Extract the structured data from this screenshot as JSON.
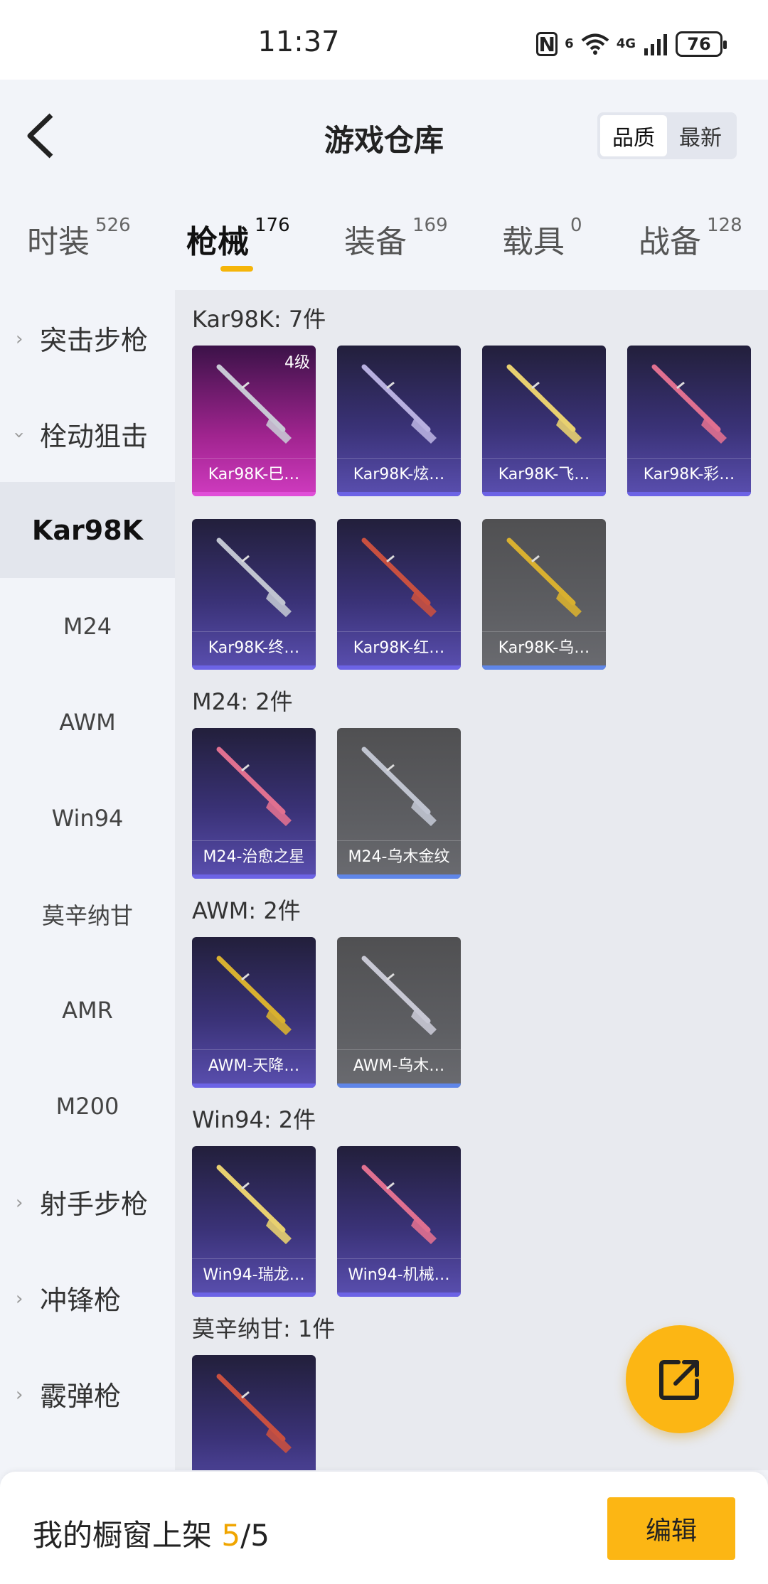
{
  "status_bar": {
    "time": "11:37",
    "battery": "76",
    "network": "4G",
    "wifi_badge": "6"
  },
  "header": {
    "title": "游戏仓库",
    "sort_options": [
      "品质",
      "最新"
    ],
    "active_sort": "品质"
  },
  "tabs": [
    {
      "label": "时装",
      "count": "526"
    },
    {
      "label": "枪械",
      "count": "176",
      "active": true
    },
    {
      "label": "装备",
      "count": "169"
    },
    {
      "label": "载具",
      "count": "0"
    },
    {
      "label": "战备",
      "count": "128"
    }
  ],
  "sidebar": {
    "group1": "突击步枪",
    "group2": "栓动狙击",
    "sub": [
      "Kar98K",
      "M24",
      "AWM",
      "Win94",
      "莫辛纳甘",
      "AMR",
      "M200"
    ],
    "active_sub": "Kar98K",
    "group3": "射手步枪",
    "group4": "冲锋枪",
    "group5": "霰弹枪"
  },
  "sections": [
    {
      "title": "Kar98K: 7件",
      "items": [
        {
          "label": "Kar98K-巳…",
          "rarity": "pink",
          "level": "4级"
        },
        {
          "label": "Kar98K-炫…",
          "rarity": "purple"
        },
        {
          "label": "Kar98K-飞…",
          "rarity": "purple"
        },
        {
          "label": "Kar98K-彩…",
          "rarity": "purple"
        },
        {
          "label": "Kar98K-终…",
          "rarity": "purple"
        },
        {
          "label": "Kar98K-红…",
          "rarity": "purple"
        },
        {
          "label": "Kar98K-乌…",
          "rarity": "grey"
        }
      ]
    },
    {
      "title": "M24: 2件",
      "items": [
        {
          "label": "M24-治愈之星",
          "rarity": "purple"
        },
        {
          "label": "M24-乌木金纹",
          "rarity": "grey"
        }
      ]
    },
    {
      "title": "AWM: 2件",
      "items": [
        {
          "label": "AWM-天降…",
          "rarity": "purple"
        },
        {
          "label": "AWM-乌木…",
          "rarity": "grey"
        }
      ]
    },
    {
      "title": "Win94: 2件",
      "items": [
        {
          "label": "Win94-瑞龙…",
          "rarity": "purple"
        },
        {
          "label": "Win94-机械…",
          "rarity": "purple"
        }
      ]
    },
    {
      "title": "莫辛纳甘: 1件",
      "items": [
        {
          "label": "",
          "rarity": "purple"
        }
      ]
    }
  ],
  "bottom_bar": {
    "label": "我的橱窗上架",
    "current": "5",
    "total": "/5",
    "edit": "编辑"
  }
}
